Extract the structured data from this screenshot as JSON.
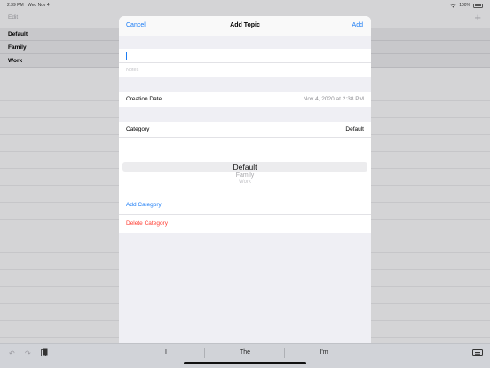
{
  "status": {
    "time": "2:39 PM",
    "date": "Wed Nov 4",
    "battery": "100%"
  },
  "background": {
    "edit_label": "Edit",
    "add_symbol": "+",
    "categories": [
      "Default",
      "Family",
      "Work"
    ]
  },
  "modal": {
    "cancel": "Cancel",
    "title": "Add Topic",
    "add": "Add",
    "notes_placeholder": "Notes",
    "creation_date_label": "Creation Date",
    "creation_date_value": "Nov 4, 2020 at 2:38 PM",
    "category_label": "Category",
    "category_value": "Default",
    "picker": {
      "selected": "Default",
      "options": [
        "Family",
        "Work"
      ]
    },
    "add_category": "Add Category",
    "delete_category": "Delete Category"
  },
  "keyboard": {
    "suggestions": [
      "I",
      "The",
      "I'm"
    ]
  },
  "colors": {
    "accent": "#1b7cf5",
    "destructive": "#ff3b30"
  }
}
